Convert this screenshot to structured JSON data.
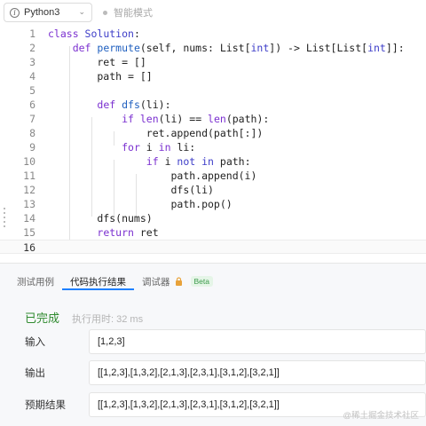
{
  "toolbar": {
    "language": "Python3",
    "smart_mode": "智能模式"
  },
  "editor": {
    "lines": [
      {
        "n": "1",
        "segments": [
          {
            "t": "class ",
            "c": "kw"
          },
          {
            "t": "Solution",
            "c": "cls"
          },
          {
            "t": ":",
            "c": ""
          }
        ]
      },
      {
        "n": "2",
        "segments": [
          {
            "t": "    ",
            "c": ""
          },
          {
            "t": "def ",
            "c": "kw"
          },
          {
            "t": "permute",
            "c": "fn"
          },
          {
            "t": "(self, nums: List[",
            "c": ""
          },
          {
            "t": "int",
            "c": "ty"
          },
          {
            "t": "]) -> List[List[",
            "c": ""
          },
          {
            "t": "int",
            "c": "ty"
          },
          {
            "t": "]]:",
            "c": ""
          }
        ]
      },
      {
        "n": "3",
        "segments": [
          {
            "t": "        ret = []",
            "c": ""
          }
        ]
      },
      {
        "n": "4",
        "segments": [
          {
            "t": "        path = []",
            "c": ""
          }
        ]
      },
      {
        "n": "5",
        "segments": [
          {
            "t": "",
            "c": ""
          }
        ]
      },
      {
        "n": "6",
        "segments": [
          {
            "t": "        ",
            "c": ""
          },
          {
            "t": "def ",
            "c": "kw"
          },
          {
            "t": "dfs",
            "c": "fn"
          },
          {
            "t": "(li):",
            "c": ""
          }
        ]
      },
      {
        "n": "7",
        "segments": [
          {
            "t": "            ",
            "c": ""
          },
          {
            "t": "if ",
            "c": "kw"
          },
          {
            "t": "len",
            "c": "bi"
          },
          {
            "t": "(li) == ",
            "c": ""
          },
          {
            "t": "len",
            "c": "bi"
          },
          {
            "t": "(path):",
            "c": ""
          }
        ]
      },
      {
        "n": "8",
        "segments": [
          {
            "t": "                ret.append(path[:])",
            "c": ""
          }
        ]
      },
      {
        "n": "9",
        "segments": [
          {
            "t": "            ",
            "c": ""
          },
          {
            "t": "for ",
            "c": "kw"
          },
          {
            "t": "i ",
            "c": ""
          },
          {
            "t": "in ",
            "c": "kw"
          },
          {
            "t": "li:",
            "c": ""
          }
        ]
      },
      {
        "n": "10",
        "segments": [
          {
            "t": "                ",
            "c": ""
          },
          {
            "t": "if ",
            "c": "kw"
          },
          {
            "t": "i ",
            "c": ""
          },
          {
            "t": "not in ",
            "c": "kw2"
          },
          {
            "t": "path:",
            "c": ""
          }
        ]
      },
      {
        "n": "11",
        "segments": [
          {
            "t": "                    path.append(i)",
            "c": ""
          }
        ]
      },
      {
        "n": "12",
        "segments": [
          {
            "t": "                    dfs(li)",
            "c": ""
          }
        ]
      },
      {
        "n": "13",
        "segments": [
          {
            "t": "                    path.pop()",
            "c": ""
          }
        ]
      },
      {
        "n": "14",
        "segments": [
          {
            "t": "        dfs(nums)",
            "c": ""
          }
        ]
      },
      {
        "n": "15",
        "segments": [
          {
            "t": "        ",
            "c": ""
          },
          {
            "t": "return ",
            "c": "kw"
          },
          {
            "t": "ret",
            "c": ""
          }
        ]
      },
      {
        "n": "16",
        "segments": [
          {
            "t": "",
            "c": ""
          }
        ]
      }
    ],
    "active_line": "16"
  },
  "panel": {
    "tabs": {
      "test_cases": "测试用例",
      "exec_result": "代码执行结果",
      "debugger": "调试器",
      "beta": "Beta"
    },
    "status": "已完成",
    "exec_time": "执行用时: 32 ms",
    "input_label": "输入",
    "input_value": "[1,2,3]",
    "output_label": "输出",
    "output_value": "[[1,2,3],[1,3,2],[2,1,3],[2,3,1],[3,1,2],[3,2,1]]",
    "expected_label": "预期结果",
    "expected_value": "[[1,2,3],[1,3,2],[2,1,3],[2,3,1],[3,1,2],[3,2,1]]"
  },
  "watermark": "@稀土掘金技术社区",
  "colors": {
    "keyword": "#7b30d0",
    "class_name": "#3d3dc8",
    "function": "#1f5fbf",
    "status_done": "#2f8a2f",
    "tab_active": "#1e80ff"
  }
}
